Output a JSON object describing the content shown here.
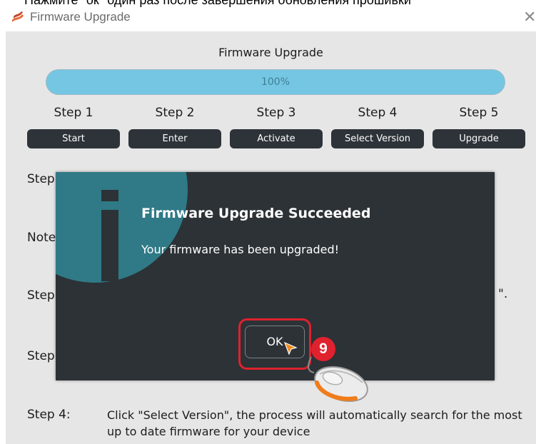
{
  "top_caption": "Нажмите \"ок\" один раз после завершения обновления прошивки",
  "window": {
    "title": "Firmware Upgrade",
    "close_icon": "close-icon"
  },
  "main": {
    "heading": "Firmware Upgrade",
    "progress": {
      "value_percent": 100,
      "label": "100%"
    },
    "steps": [
      {
        "label": "Step 1",
        "button": "Start"
      },
      {
        "label": "Step 2",
        "button": "Enter"
      },
      {
        "label": "Step 3",
        "button": "Activate"
      },
      {
        "label": "Step 4",
        "button": "Select Version"
      },
      {
        "label": "Step 5",
        "button": "Upgrade"
      }
    ],
    "background_lines": {
      "line1": "Step",
      "line2": "Note",
      "line3": "Step",
      "line3_end": "\".",
      "line4": "Step",
      "step4_label": "Step 4:",
      "step4_text": "Click \"Select Version\", the process will automatically search for the most up to date firmware for your device"
    }
  },
  "dialog": {
    "icon": "info-icon",
    "title": "Firmware Upgrade Succeeded",
    "message": "Your firmware has been upgraded!",
    "ok_label": "OK"
  },
  "annotation": {
    "step_number": "9",
    "highlight_color": "#e0212e"
  },
  "colors": {
    "dialog_bg": "#2c3236",
    "progress": "#75c6e2",
    "button_bg": "#2d3339",
    "panel_bg": "#e6e6e6"
  }
}
